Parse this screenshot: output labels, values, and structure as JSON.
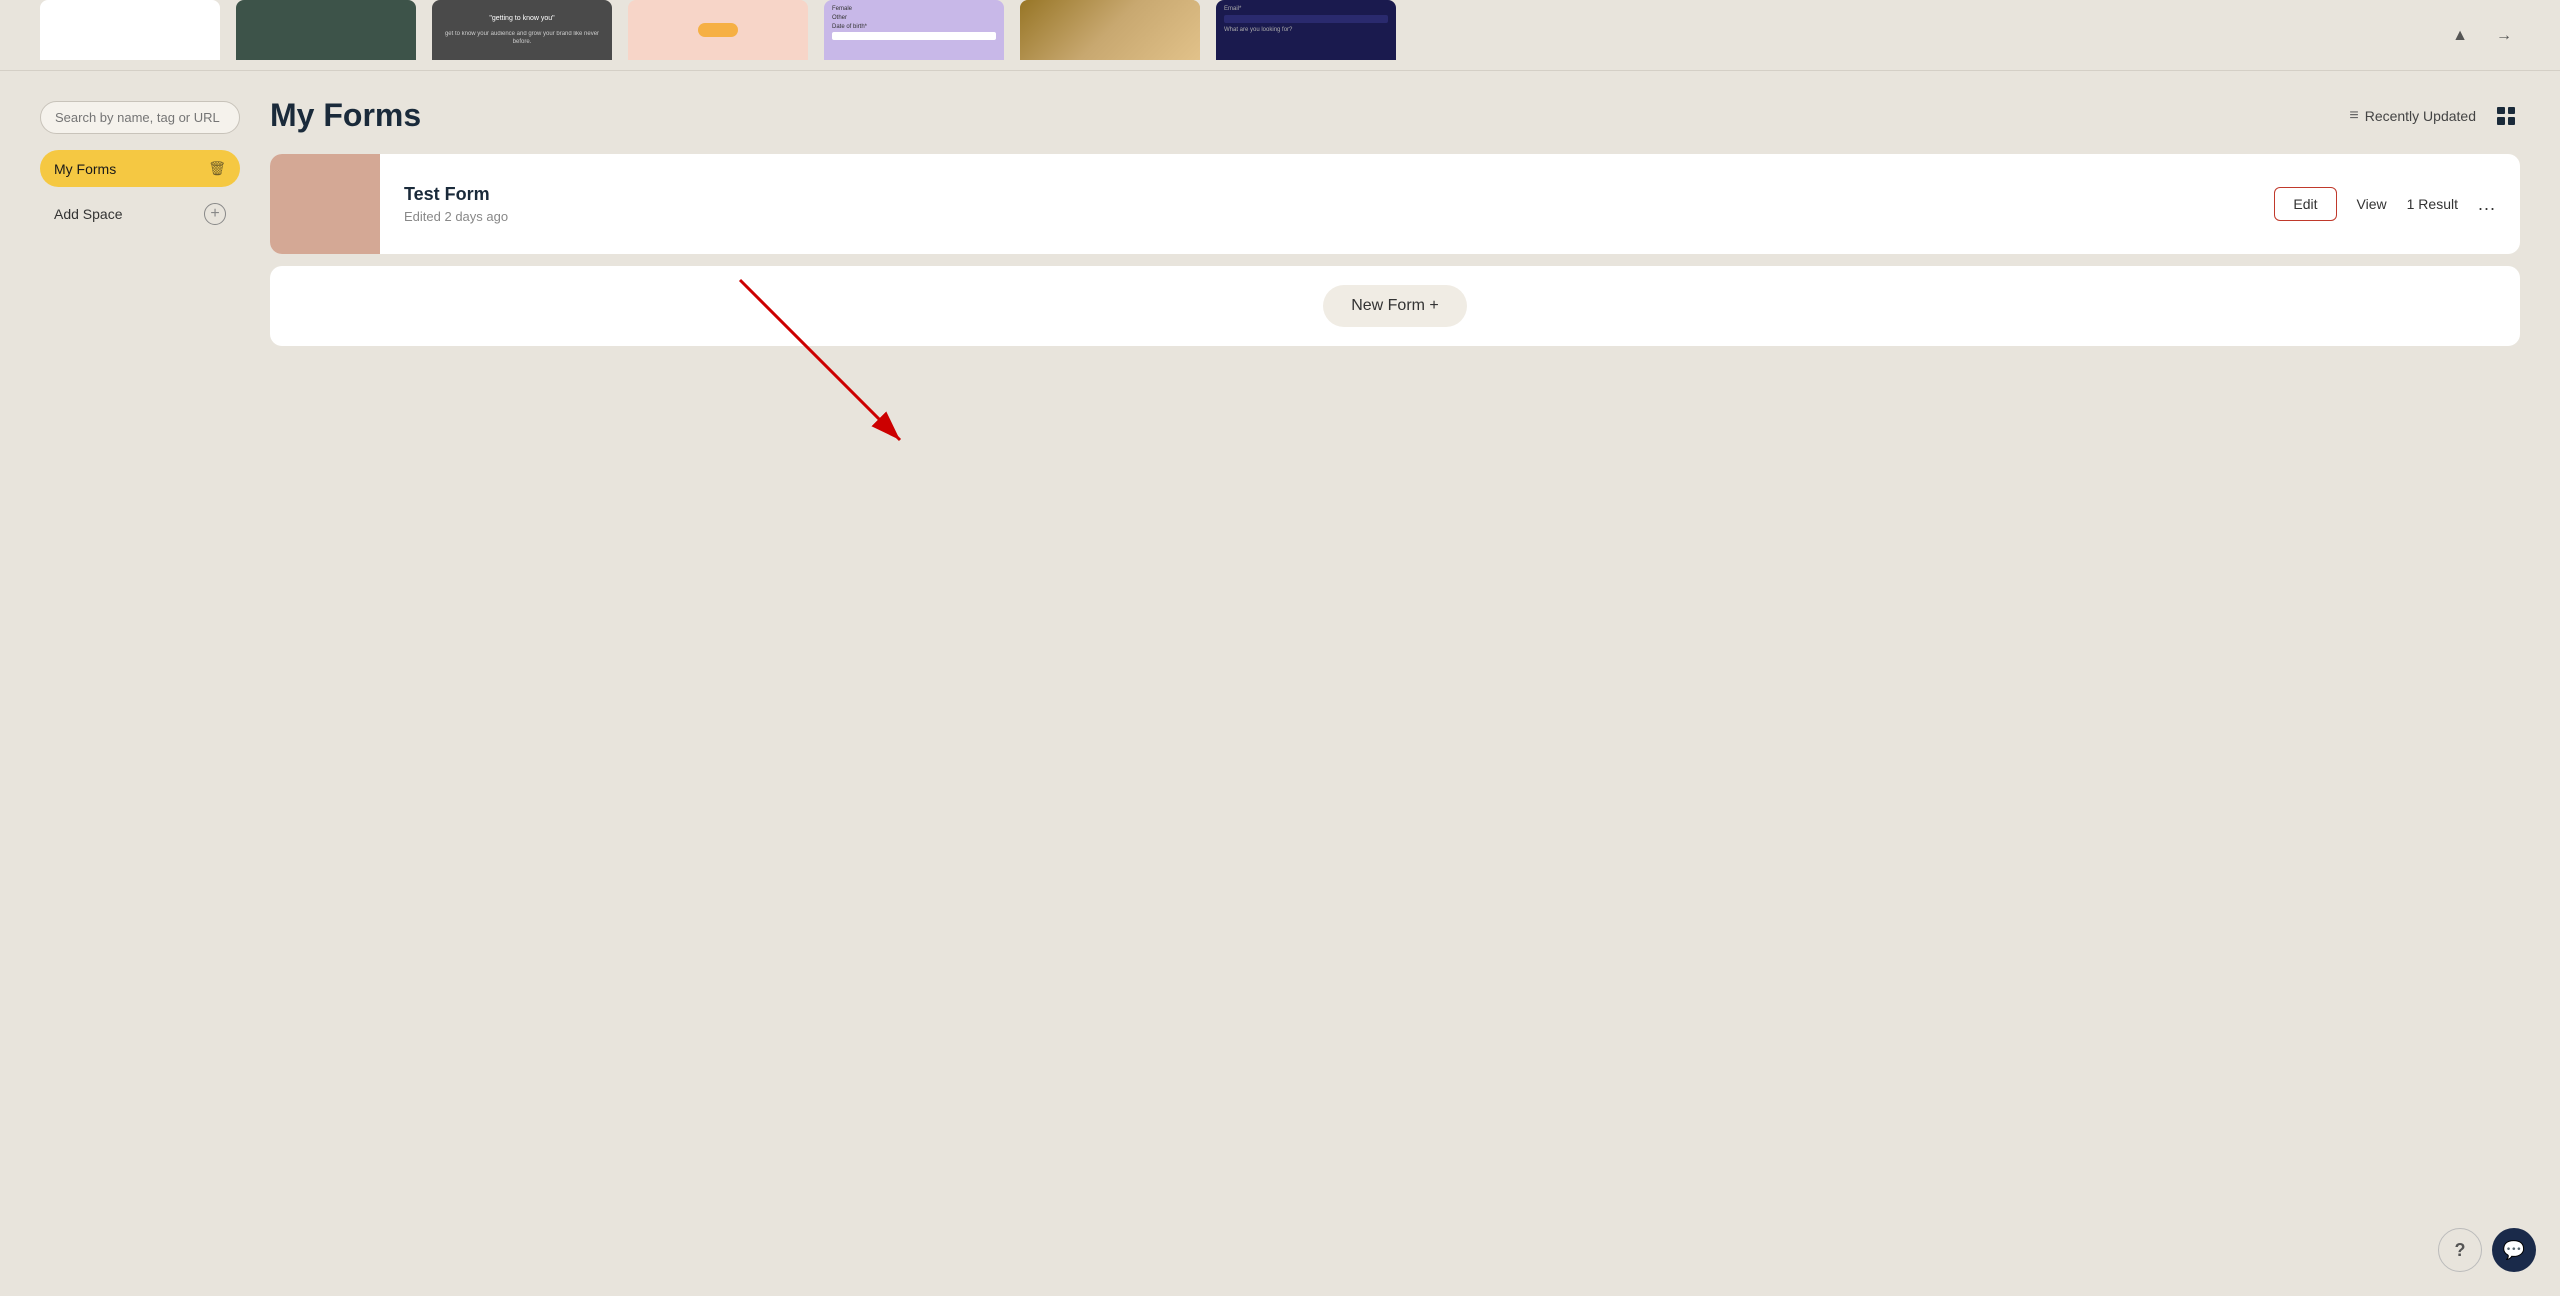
{
  "carousel": {
    "templates": [
      {
        "id": 1,
        "style": "white",
        "label": ""
      },
      {
        "id": 2,
        "style": "dark-teal",
        "label": ""
      },
      {
        "id": 3,
        "style": "dark-charcoal",
        "label": "\"getting to know you\""
      },
      {
        "id": 4,
        "style": "peach",
        "label": ""
      },
      {
        "id": 5,
        "style": "purple",
        "label": ""
      },
      {
        "id": 6,
        "style": "photo",
        "label": ""
      },
      {
        "id": 7,
        "style": "blue-dark",
        "label": ""
      }
    ],
    "prev_label": "▲",
    "next_label": "→"
  },
  "sidebar": {
    "search_placeholder": "Search by name, tag or URL",
    "my_forms_label": "My Forms",
    "add_space_label": "Add Space"
  },
  "forms_section": {
    "title": "My Forms",
    "sort_label": "Recently Updated",
    "forms": [
      {
        "id": 1,
        "name": "Test Form",
        "edited": "Edited 2 days ago",
        "thumbnail_color": "#d4a895"
      }
    ],
    "new_form_label": "New Form +"
  },
  "help": {
    "question_label": "?",
    "chat_label": "💬"
  }
}
